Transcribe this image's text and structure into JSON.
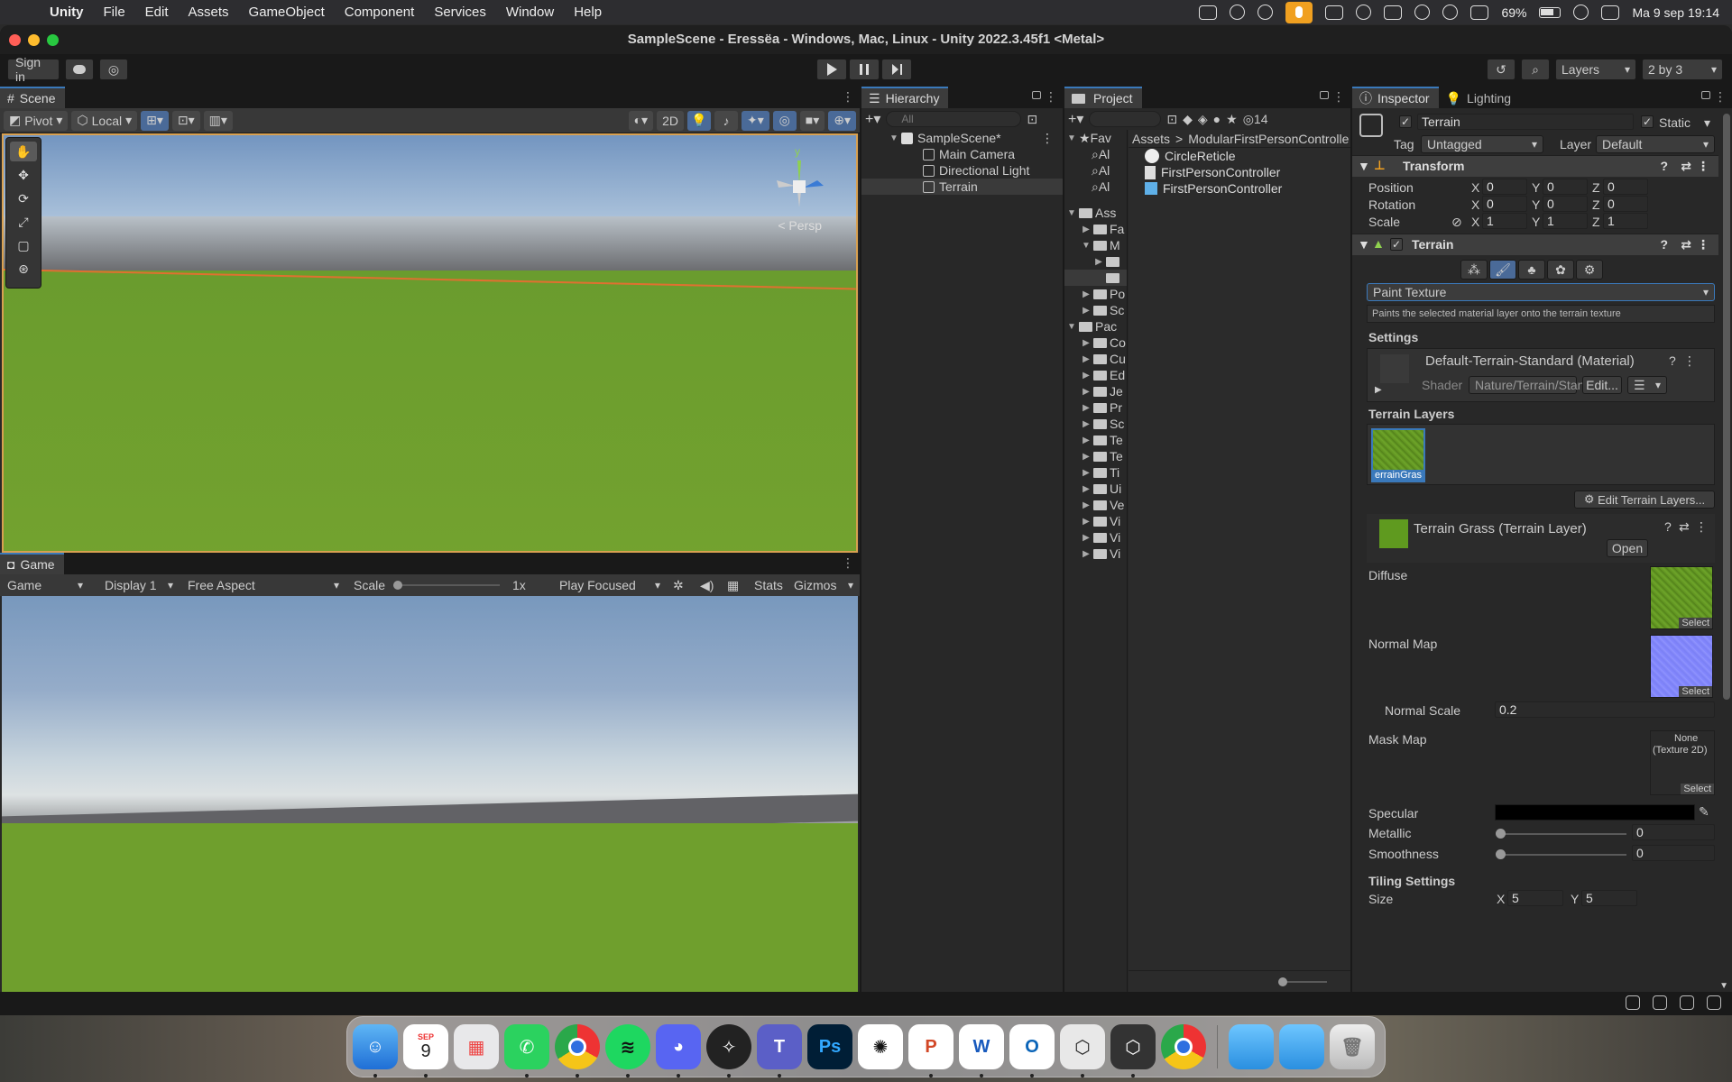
{
  "menubar": {
    "app_name": "Unity",
    "items": [
      "File",
      "Edit",
      "Assets",
      "GameObject",
      "Component",
      "Services",
      "Window",
      "Help"
    ],
    "battery": "69%",
    "datetime": "Ma 9 sep  19:14"
  },
  "window": {
    "title": "SampleScene - Eressëa - Windows, Mac, Linux - Unity 2022.3.45f1 <Metal>"
  },
  "toolbar": {
    "sign_in": "Sign in",
    "layers_label": "Layers",
    "layout_label": "2 by 3"
  },
  "scene": {
    "tab": "Scene",
    "pivot": "Pivot",
    "local": "Local",
    "two_d": "2D",
    "persp": "Persp",
    "gizmo_axis": "y"
  },
  "game": {
    "tab": "Game",
    "mode": "Game",
    "display": "Display 1",
    "aspect": "Free Aspect",
    "scale_label": "Scale",
    "scale_value": "1x",
    "play_focused": "Play Focused",
    "stats": "Stats",
    "gizmos": "Gizmos"
  },
  "hierarchy": {
    "tab": "Hierarchy",
    "search_placeholder": "All",
    "scene_name": "SampleScene*",
    "items": [
      "Main Camera",
      "Directional Light",
      "Terrain"
    ]
  },
  "project": {
    "tab": "Project",
    "count": "14",
    "breadcrumb_root": "Assets",
    "breadcrumb_folder": "ModularFirstPersonControlle",
    "favorites": "Fav",
    "fav_items": [
      "Al",
      "Al",
      "Al"
    ],
    "assets_label": "Ass",
    "asset_tree": [
      "Fa",
      "M",
      "",
      "",
      "Po",
      "Sc"
    ],
    "packages_label": "Pac",
    "package_items": [
      "Co",
      "Cu",
      "Ed",
      "Je",
      "Pr",
      "Sc",
      "Te",
      "Te",
      "Ti",
      "Ui",
      "Ve",
      "Vi",
      "Vi",
      "Vi"
    ],
    "assets": [
      "CircleReticle",
      "FirstPersonController",
      "FirstPersonController"
    ]
  },
  "inspector": {
    "tab": "Inspector",
    "lighting_tab": "Lighting",
    "object_name": "Terrain",
    "static_label": "Static",
    "tag_label": "Tag",
    "tag_value": "Untagged",
    "layer_label": "Layer",
    "layer_value": "Default",
    "transform": {
      "title": "Transform",
      "position_label": "Position",
      "rotation_label": "Rotation",
      "scale_label": "Scale",
      "position": [
        "0",
        "0",
        "0"
      ],
      "rotation": [
        "0",
        "0",
        "0"
      ],
      "scale": [
        "1",
        "1",
        "1"
      ],
      "axes": [
        "X",
        "Y",
        "Z"
      ]
    },
    "terrain": {
      "title": "Terrain",
      "tool_dropdown": "Paint Texture",
      "tool_description": "Paints the selected material layer onto the terrain texture",
      "settings_label": "Settings",
      "material_name": "Default-Terrain-Standard (Material)",
      "shader_label": "Shader",
      "shader_value": "Nature/Terrain/Stan",
      "edit_button": "Edit...",
      "terrain_layers_label": "Terrain Layers",
      "layer_thumb_label": "errainGras",
      "edit_layers_button": "Edit Terrain Layers...",
      "layer_asset_name": "Terrain Grass (Terrain Layer)",
      "open_button": "Open",
      "diffuse_label": "Diffuse",
      "normal_map_label": "Normal Map",
      "select_label": "Select",
      "normal_scale_label": "Normal Scale",
      "normal_scale_value": "0.2",
      "mask_map_label": "Mask Map",
      "mask_none": "None",
      "mask_type": "(Texture 2D)",
      "specular_label": "Specular",
      "metallic_label": "Metallic",
      "metallic_value": "0",
      "smoothness_label": "Smoothness",
      "smoothness_value": "0",
      "tiling_label": "Tiling Settings",
      "size_label": "Size",
      "size_x": "5",
      "size_y": "5"
    }
  },
  "dock": {
    "calendar_month": "SEP",
    "calendar_day": "9",
    "apps": [
      "finder-icon",
      "calendar-icon",
      "launchpad-icon",
      "whatsapp-icon",
      "chrome-icon",
      "spotify-icon",
      "discord-icon",
      "safari-icon",
      "teams-icon",
      "photoshop-icon",
      "chatgpt-icon",
      "powerpoint-icon",
      "word-icon",
      "outlook-icon",
      "unity-hub-icon",
      "unity-icon",
      "chrome-canary-icon",
      "folder-icon",
      "folder-icon",
      "trash-icon"
    ]
  }
}
